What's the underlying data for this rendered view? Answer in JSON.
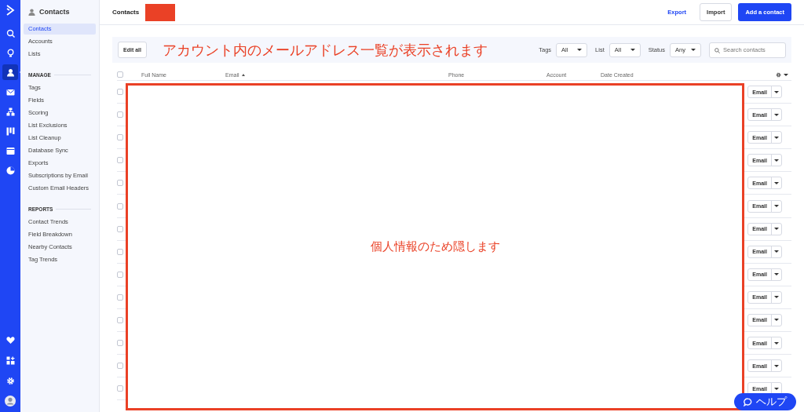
{
  "rail": {
    "top": [
      {
        "kind": "search",
        "selected": false
      },
      {
        "kind": "bulb",
        "selected": false
      },
      {
        "kind": "person",
        "selected": true
      },
      {
        "kind": "mail",
        "selected": false
      },
      {
        "kind": "flow",
        "selected": false
      },
      {
        "kind": "board",
        "selected": false
      },
      {
        "kind": "window",
        "selected": false
      },
      {
        "kind": "pie",
        "selected": false
      }
    ],
    "bottom": [
      {
        "kind": "heart",
        "selected": false
      },
      {
        "kind": "apps",
        "selected": false
      },
      {
        "kind": "gear",
        "selected": false
      },
      {
        "kind": "avatar",
        "selected": false
      }
    ]
  },
  "sidebar": {
    "title": "Contacts",
    "items": [
      {
        "label": "Contacts",
        "selected": true
      },
      {
        "label": "Accounts",
        "selected": false
      },
      {
        "label": "Lists",
        "selected": false
      }
    ],
    "sections": [
      {
        "heading": "MANAGE",
        "items": [
          {
            "label": "Tags",
            "selected": false
          },
          {
            "label": "Fields",
            "selected": false
          },
          {
            "label": "Scoring",
            "selected": false
          },
          {
            "label": "List Exclusions",
            "selected": false
          },
          {
            "label": "List Cleanup",
            "selected": false
          },
          {
            "label": "Database Sync",
            "selected": false
          },
          {
            "label": "Exports",
            "selected": false
          },
          {
            "label": "Subscriptions by Email",
            "selected": false
          },
          {
            "label": "Custom Email Headers",
            "selected": false
          }
        ]
      },
      {
        "heading": "REPORTS",
        "items": [
          {
            "label": "Contact Trends",
            "selected": false
          },
          {
            "label": "Field Breakdown",
            "selected": false
          },
          {
            "label": "Nearby Contacts",
            "selected": false
          },
          {
            "label": "Tag Trends",
            "selected": false
          }
        ]
      }
    ]
  },
  "header": {
    "title": "Contacts",
    "actions": [
      {
        "label": "Export",
        "kind": "link"
      },
      {
        "label": "Import",
        "kind": "secondary"
      },
      {
        "label": "Add a contact",
        "kind": "primary"
      }
    ]
  },
  "toolbar": {
    "edit_button": "Edit all",
    "filters": [
      {
        "label": "Tags",
        "value": "All"
      },
      {
        "label": "List",
        "value": "All"
      },
      {
        "label": "Status",
        "value": "Any"
      }
    ],
    "search": {
      "placeholder": "Search contacts"
    }
  },
  "table": {
    "select_all_checked": false,
    "columns": [
      {
        "label": "Full Name",
        "sorted": false
      },
      {
        "label": "Email",
        "sorted": true
      },
      {
        "label": "Phone",
        "sorted": false
      },
      {
        "label": "Account",
        "sorted": false
      },
      {
        "label": "Date Created",
        "sorted": false
      }
    ],
    "rows": [
      {
        "checked": false,
        "action": "Email"
      },
      {
        "checked": false,
        "action": "Email"
      },
      {
        "checked": false,
        "action": "Email"
      },
      {
        "checked": false,
        "action": "Email"
      },
      {
        "checked": false,
        "action": "Email"
      },
      {
        "checked": false,
        "action": "Email"
      },
      {
        "checked": false,
        "action": "Email"
      },
      {
        "checked": false,
        "action": "Email"
      },
      {
        "checked": false,
        "action": "Email"
      },
      {
        "checked": false,
        "action": "Email"
      },
      {
        "checked": false,
        "action": "Email"
      },
      {
        "checked": false,
        "action": "Email"
      },
      {
        "checked": false,
        "action": "Email"
      },
      {
        "checked": false,
        "action": "Email"
      }
    ]
  },
  "annotations": {
    "caption": "アカウント内のメールアドレス一覧が表示されます",
    "redaction_note": "個人情報のため隠します"
  },
  "help_button": {
    "label": "ヘルプ"
  }
}
